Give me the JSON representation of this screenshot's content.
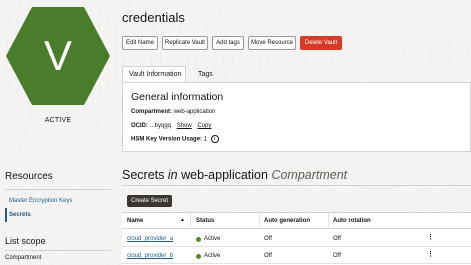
{
  "resource": {
    "letter": "V",
    "state": "ACTIVE",
    "icon_color": "#4a7d2b",
    "title": "credentials"
  },
  "actions": {
    "edit_name": "Edit Name",
    "replicate_vault": "Replicate Vault",
    "add_tags": "Add tags",
    "move_resource": "Move Resource",
    "delete_vault": "Delete Vault"
  },
  "tabs": {
    "vault_information": "Vault Information",
    "tags": "Tags"
  },
  "info": {
    "heading": "General information",
    "compartment_label": "Compartment:",
    "compartment_value": "web-application",
    "ocid_label": "OCID:",
    "ocid_value": "...byqgq",
    "ocid_show": "Show",
    "ocid_copy": "Copy",
    "hsm_label": "HSM Key Version Usage:",
    "hsm_value": "1",
    "info_icon": "i"
  },
  "resources": {
    "title": "Resources",
    "items": [
      {
        "label": "Master Encryption Keys"
      },
      {
        "label": "Secrets"
      }
    ]
  },
  "list_scope": {
    "title": "List scope",
    "compartment_label": "Compartment"
  },
  "secrets": {
    "title_main": "Secrets",
    "title_in": "in",
    "title_compartment": "web-application",
    "title_suffix": "Compartment",
    "create_button": "Create Secret",
    "columns": [
      "Name",
      "Status",
      "Auto generation",
      "Auto rotation"
    ],
    "sort_icon": "▲",
    "rows": [
      {
        "name": "cloud_provider_a",
        "status": "Active",
        "auto_generation": "Off",
        "auto_rotation": "Off"
      },
      {
        "name": "cloud_provider_b",
        "status": "Active",
        "auto_generation": "Off",
        "auto_rotation": "Off"
      }
    ],
    "kebab_icon": "⋮"
  }
}
